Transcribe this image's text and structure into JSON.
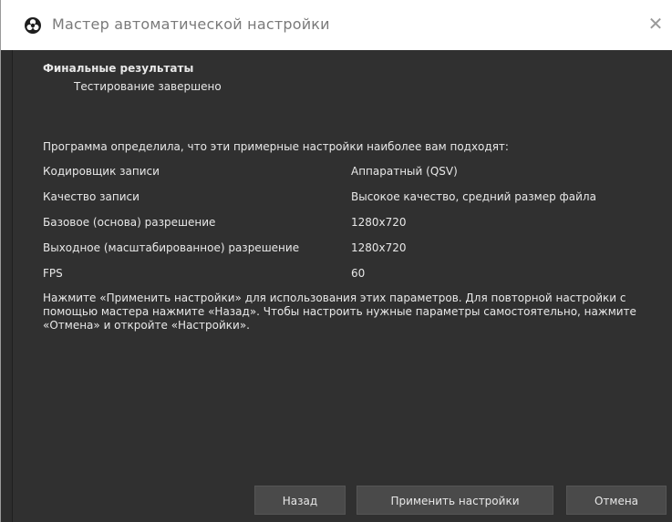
{
  "window": {
    "title": "Мастер автоматической настройки",
    "close_glyph": "✕"
  },
  "results": {
    "heading": "Финальные результаты",
    "subheading": "Тестирование завершено",
    "intro": "Программа определила, что эти примерные настройки наиболее вам подходят:",
    "rows": [
      {
        "label": "Кодировщик записи",
        "value": "Аппаратный (QSV)"
      },
      {
        "label": "Качество записи",
        "value": "Высокое качество, средний размер файла"
      },
      {
        "label": "Базовое (основа) разрешение",
        "value": "1280x720"
      },
      {
        "label": "Выходное (масштабированное) разрешение",
        "value": "1280x720"
      },
      {
        "label": "FPS",
        "value": "60"
      }
    ],
    "note": "Нажмите «Применить настройки» для использования этих параметров. Для повторной настройки с помощью мастера нажмите «Назад». Чтобы настроить нужные параметры самостоятельно, нажмите «Отмена» и откройте «Настройки»."
  },
  "buttons": {
    "back": "Назад",
    "apply": "Применить настройки",
    "cancel": "Отмена"
  },
  "colors": {
    "background": "#303030",
    "titlebar": "#ffffff",
    "button": "#4a4a4a",
    "text": "#e8e8e8"
  },
  "icons": {
    "app": "obs-logo-icon",
    "close": "close-icon"
  }
}
